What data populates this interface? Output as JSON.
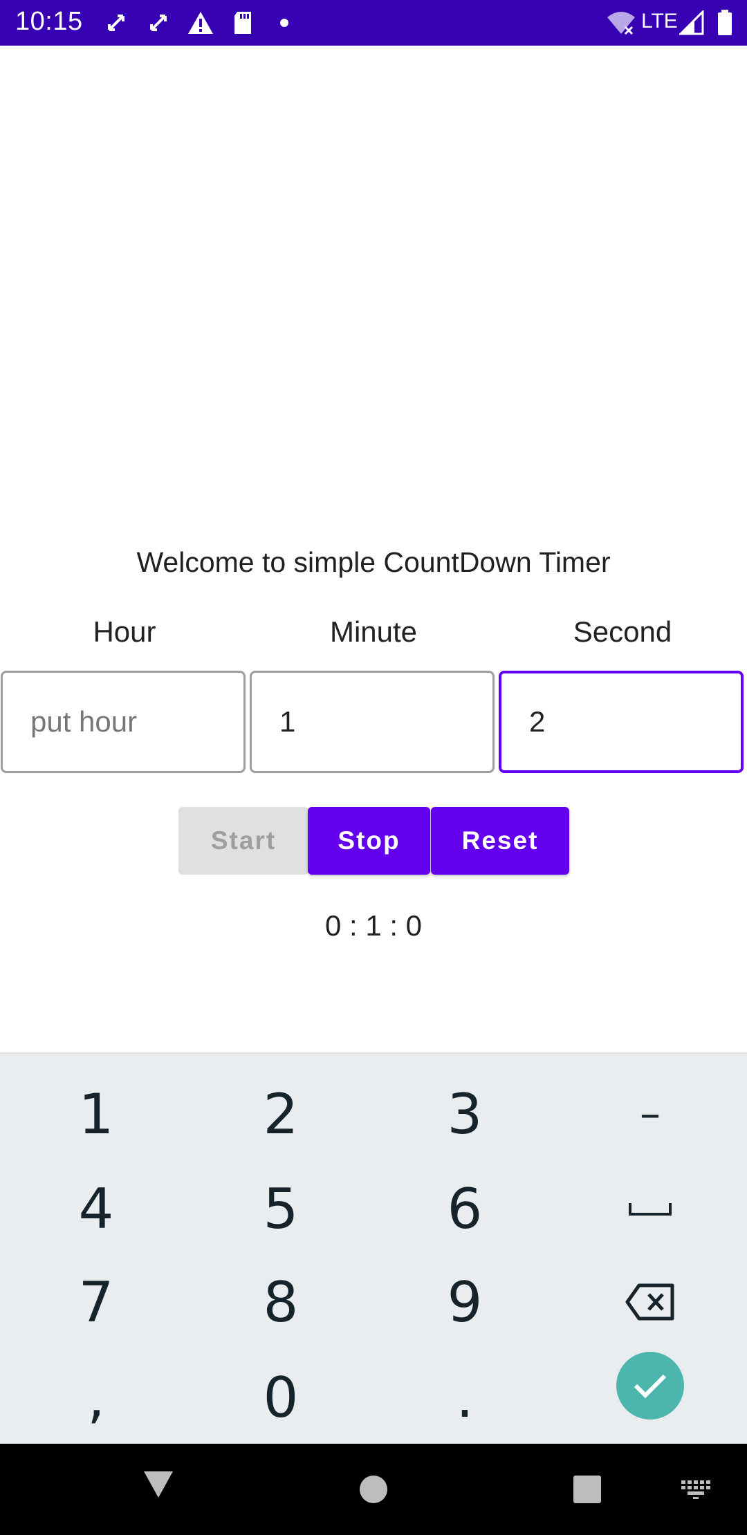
{
  "status_bar": {
    "time": "10:15",
    "network": "LTE",
    "icons": [
      "sync-icon",
      "sync-icon",
      "warning-icon",
      "sd-card-icon",
      "dot-icon",
      "wifi-off-icon",
      "signal-icon",
      "battery-icon"
    ]
  },
  "app": {
    "welcome": "Welcome to simple CountDown Timer",
    "labels": {
      "hour": "Hour",
      "minute": "Minute",
      "second": "Second"
    },
    "fields": {
      "hour": {
        "value": "",
        "placeholder": "put hour"
      },
      "minute": {
        "value": "1",
        "placeholder": ""
      },
      "second": {
        "value": "2",
        "placeholder": ""
      }
    },
    "buttons": {
      "start": "Start",
      "stop": "Stop",
      "reset": "Reset"
    },
    "timer_readout": "0 : 1 : 0",
    "accent_color": "#6200ee"
  },
  "keyboard": {
    "keys": [
      "1",
      "2",
      "3",
      "–",
      "4",
      "5",
      "6",
      "␣",
      "7",
      "8",
      "9",
      "⌫",
      ",",
      "0",
      ".",
      "✓"
    ],
    "done_color": "#4db6ac"
  },
  "nav_bar": {
    "buttons": [
      "back",
      "home",
      "recents",
      "keyboard-switch"
    ]
  }
}
